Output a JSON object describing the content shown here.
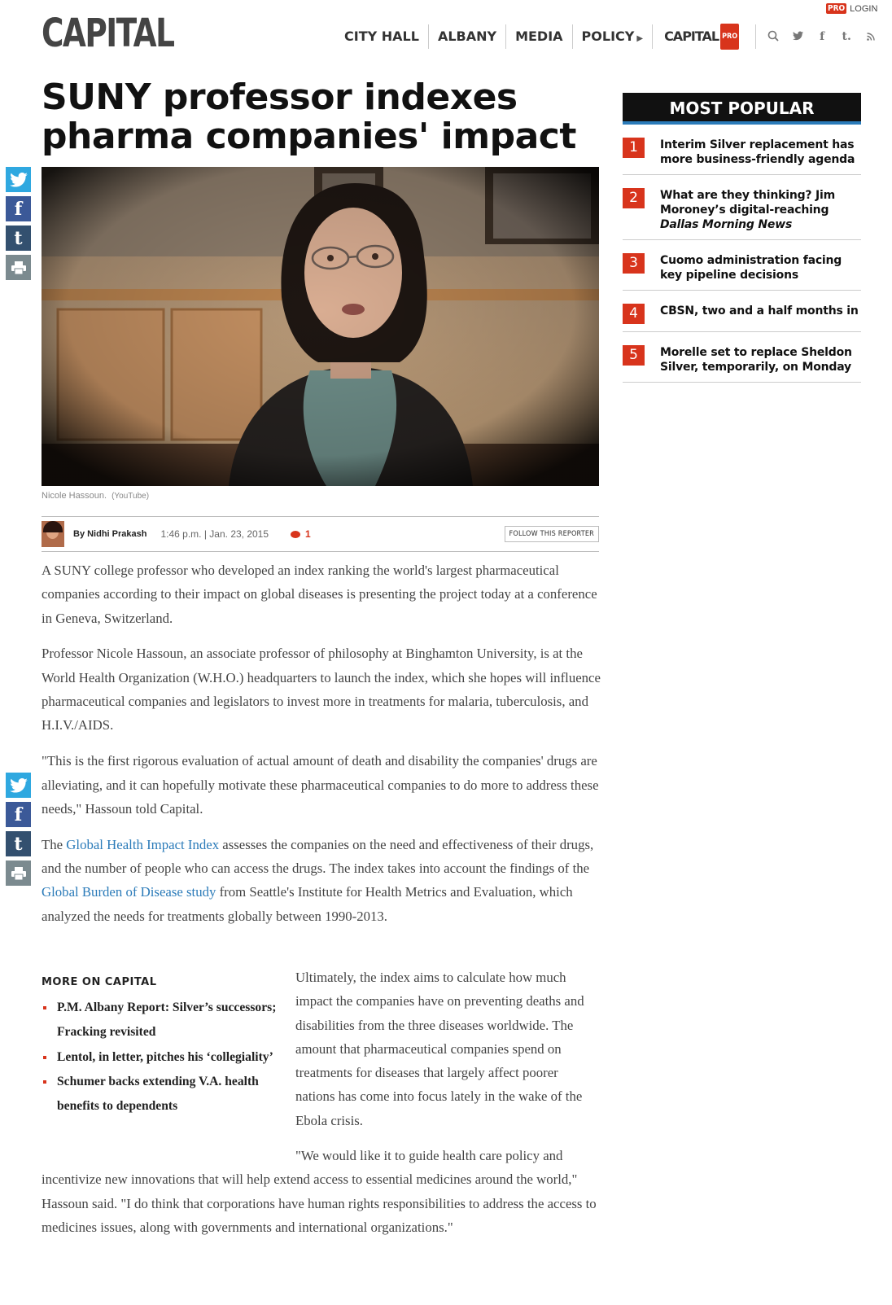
{
  "header": {
    "logo": "CAPITAL",
    "pro_badge": "PRO",
    "login": "LOGIN",
    "nav": [
      "CITY HALL",
      "ALBANY",
      "MEDIA",
      "POLICY"
    ],
    "capital_pro_label": "CAPITAL",
    "icons": [
      "search-icon",
      "twitter-icon",
      "facebook-icon",
      "tumblr-icon",
      "rss-icon"
    ]
  },
  "article": {
    "headline": "SUNY professor indexes pharma companies' impact",
    "caption": "Nicole Hassoun.",
    "caption_source": "(YouTube)",
    "byline": "By Nidhi Prakash",
    "time": "1:46 p.m. | Jan. 23, 2015",
    "comment_count": "1",
    "follow_label": "FOLLOW THIS REPORTER",
    "paragraphs": [
      "A SUNY college professor who developed an index ranking the world's largest pharmaceutical companies according to their impact on global diseases is presenting the project today at a conference in Geneva, Switzerland.",
      "Professor Nicole Hassoun, an associate professor of philosophy at Binghamton University, is at the World Health Organization (W.H.O.) headquarters to launch the index, which she hopes will influence pharmaceutical companies and legislators to invest more in treatments for malaria, tuberculosis, and H.I.V./AIDS.",
      "\"This is the first rigorous evaluation of actual amount of death and disability the companies' drugs are alleviating, and it can hopefully motivate these pharmaceutical companies to do more to address these needs,\" Hassoun told Capital."
    ],
    "p4": {
      "part1": "The ",
      "link1": "Global Health Impact Index",
      "part2": " assesses the companies on the need and effectiveness of their drugs, and the number of people who can access the drugs. The index takes into account the findings of the ",
      "link2": "Global Burden of Disease study",
      "part3": " from Seattle's Institute for Health Metrics and Evaluation, which analyzed the needs for treatments globally between 1990-2013."
    },
    "p5": "Ultimately, the index aims to calculate how much impact the companies have on preventing deaths and disabilities from the three diseases worldwide. The amount that pharmaceutical companies spend on treatments for diseases that largely affect poorer nations has come into focus lately in the wake of the Ebola crisis.",
    "p6": "\"We would like it to guide health care policy and incentivize new innovations that will help extend access to essential medicines around the world,\" Hassoun said. \"I do think that corporations have human rights responsibilities to address the access to medicines issues, along with governments and international organizations.\""
  },
  "more_on_capital": {
    "title": "MORE ON CAPITAL",
    "items": [
      "P.M. Albany Report: Silver’s successors; Fracking revisited",
      "Lentol, in letter, pitches his ‘collegiality’",
      "Schumer backs extending V.A. health benefits to dependents"
    ]
  },
  "most_popular": {
    "title": "MOST POPULAR",
    "items": [
      {
        "num": "1",
        "text": "Interim Silver replacement has more business-friendly agenda"
      },
      {
        "num": "2",
        "text_a": "What are they thinking? Jim Moroney’s digital-reaching ",
        "text_em": "Dallas Morning News"
      },
      {
        "num": "3",
        "text": "Cuomo administration facing key pipeline decisions"
      },
      {
        "num": "4",
        "text": "CBSN, two and a half months in"
      },
      {
        "num": "5",
        "text": "Morelle set to replace Sheldon Silver, temporarily, on Monday"
      }
    ]
  },
  "share_icons": [
    "twitter-icon",
    "facebook-icon",
    "tumblr-icon",
    "print-icon"
  ]
}
